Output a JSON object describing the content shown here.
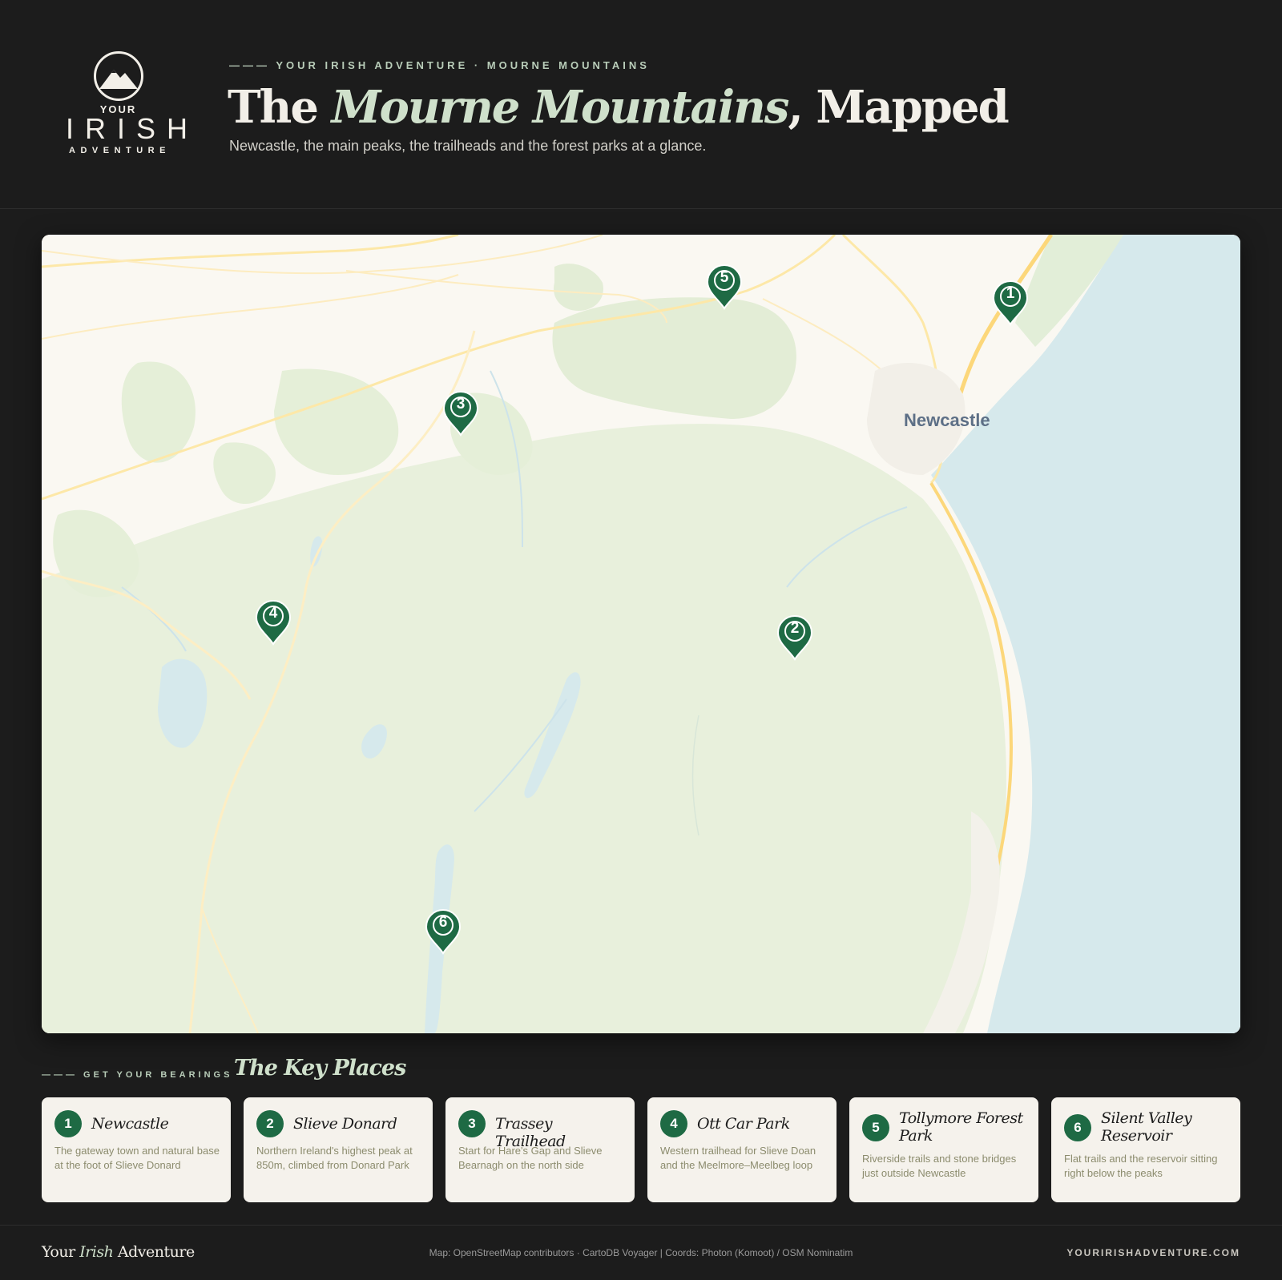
{
  "header": {
    "logo": {
      "line1": "YOUR",
      "line2": "IRISH",
      "line3": "ADVENTURE"
    },
    "eyebrow": "——— YOUR IRISH ADVENTURE · MOURNE MOUNTAINS",
    "title_pre": "The ",
    "title_em": "Mourne Mountains",
    "title_post": ", Mapped",
    "subtitle": "Newcastle, the main peaks, the trailheads and the forest parks at a glance."
  },
  "map": {
    "town_label": "Newcastle",
    "pins": [
      {
        "number": "1",
        "name": "Newcastle"
      },
      {
        "number": "2",
        "name": "Slieve Donard"
      },
      {
        "number": "3",
        "name": "Trassey Trailhead"
      },
      {
        "number": "4",
        "name": "Ott Car Park"
      },
      {
        "number": "5",
        "name": "Tollymore Forest Park"
      },
      {
        "number": "6",
        "name": "Silent Valley Reservoir"
      }
    ]
  },
  "key_places": {
    "eyebrow": "——— GET YOUR BEARINGS",
    "title": "The Key Places",
    "cards": [
      {
        "number": "1",
        "name": "Newcastle",
        "desc": "The gateway town and natural base at the foot of Slieve Donard"
      },
      {
        "number": "2",
        "name": "Slieve Donard",
        "desc": "Northern Ireland's highest peak at 850m, climbed from Donard Park"
      },
      {
        "number": "3",
        "name": "Trassey Trailhead",
        "desc": "Start for Hare's Gap and Slieve Bearnagh on the north side"
      },
      {
        "number": "4",
        "name": "Ott Car Park",
        "desc": "Western trailhead for Slieve Doan and the Meelmore–Meelbeg loop"
      },
      {
        "number": "5",
        "name": "Tollymore Forest Park",
        "desc": "Riverside trails and stone bridges just outside Newcastle"
      },
      {
        "number": "6",
        "name": "Silent Valley Reservoir",
        "desc": "Flat trails and the reservoir sitting right below the peaks"
      }
    ]
  },
  "footer": {
    "brand_pre": "Your ",
    "brand_em": "Irish",
    "brand_post": " Adventure",
    "credits": "Map: OpenStreetMap contributors · CartoDB Voyager | Coords: Photon (Komoot) / OSM Nominatim",
    "url": "YOURIRISHADVENTURE.COM"
  },
  "colors": {
    "background": "#1c1c1c",
    "accent_green": "#1e6a44",
    "sage": "#cfe0cb",
    "card_bg": "#f5f2ec",
    "sea": "#d6e9ec",
    "park": "#e8f0dc"
  },
  "icons": {
    "logo": "mountain-logo-icon",
    "pin": "map-pin-icon"
  }
}
